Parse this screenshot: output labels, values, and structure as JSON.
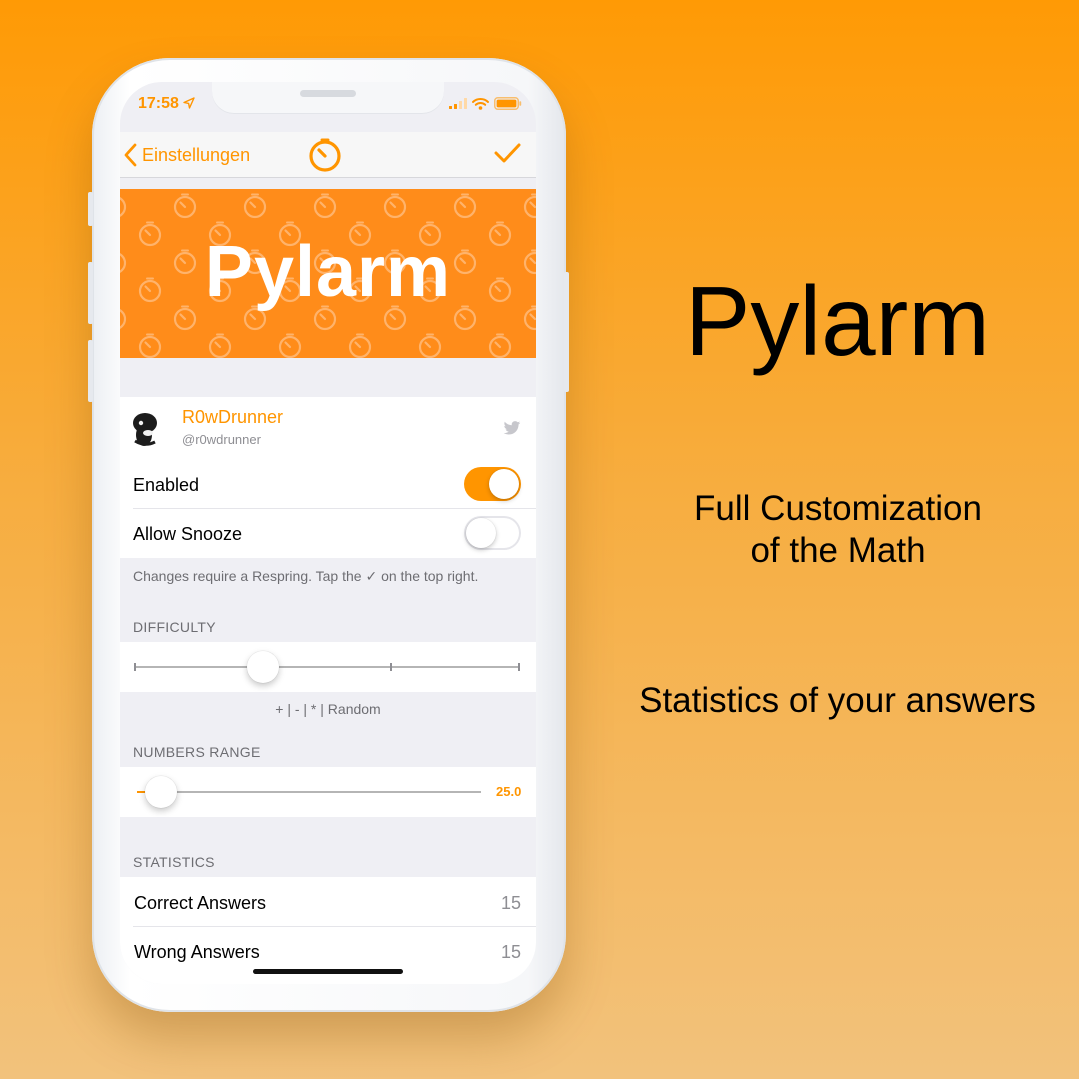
{
  "promo": {
    "title": "Pylarm",
    "feature1_line1": "Full Customization",
    "feature1_line2": "of the Math",
    "feature2": "Statistics of your answers"
  },
  "status_bar": {
    "time": "17:58"
  },
  "nav": {
    "back_label": "Einstellungen"
  },
  "banner": {
    "title": "Pylarm"
  },
  "developer": {
    "name": "R0wDrunner",
    "handle": "@r0wdrunner"
  },
  "settings": {
    "enabled_label": "Enabled",
    "enabled_value": true,
    "snooze_label": "Allow Snooze",
    "snooze_value": false,
    "footer": "Changes require a Respring. Tap the ✓ on the top right."
  },
  "difficulty": {
    "header": "DIFFICULTY",
    "level_index": 1,
    "levels": 4,
    "footer": "+ | - | * | Random"
  },
  "numbers_range": {
    "header": "NUMBERS RANGE",
    "value_text": "25.0",
    "fraction": 0.05
  },
  "statistics": {
    "header": "STATISTICS",
    "rows": [
      {
        "label": "Correct Answers",
        "value": "15"
      },
      {
        "label": "Wrong Answers",
        "value": "15"
      }
    ]
  },
  "colors": {
    "accent": "#ff9500",
    "banner": "#ff8c1a"
  }
}
